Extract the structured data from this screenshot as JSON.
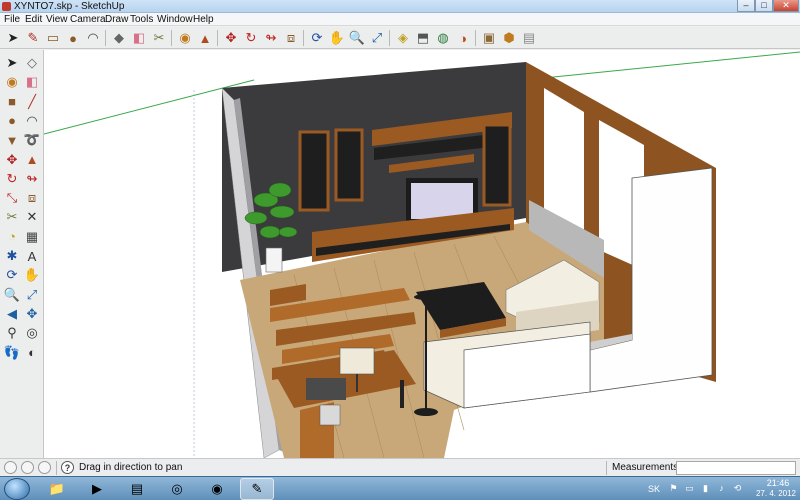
{
  "window": {
    "title": "XYNTO7.skp - SketchUp",
    "minimize": "–",
    "maximize": "□",
    "close": "✕"
  },
  "menu": [
    "File",
    "Edit",
    "View",
    "Camera",
    "Draw",
    "Tools",
    "Window",
    "Help"
  ],
  "toolbar": {
    "tools": [
      {
        "name": "select-tool",
        "glyph": "➤",
        "color": "#222222"
      },
      {
        "name": "pencil-line-tool",
        "glyph": "✎",
        "color": "#b03020"
      },
      {
        "name": "rectangle-tool",
        "glyph": "▭",
        "color": "#8a5a2b"
      },
      {
        "name": "circle-tool",
        "glyph": "●",
        "color": "#8a5a2b"
      },
      {
        "name": "arc-tool",
        "glyph": "◠",
        "color": "#444444"
      },
      {
        "name": "make-component-tool",
        "glyph": "◆",
        "color": "#666666"
      },
      {
        "name": "eraser-tool",
        "glyph": "◧",
        "color": "#d8708a"
      },
      {
        "name": "tape-measure-tool",
        "glyph": "✂",
        "color": "#6a7a3a"
      },
      {
        "name": "paint-bucket-tool",
        "glyph": "◉",
        "color": "#c07a20"
      },
      {
        "name": "push-pull-tool",
        "glyph": "▲",
        "color": "#b04a20"
      },
      {
        "name": "move-tool",
        "glyph": "✥",
        "color": "#b02020"
      },
      {
        "name": "rotate-tool",
        "glyph": "↻",
        "color": "#c02020"
      },
      {
        "name": "follow-me-tool",
        "glyph": "↬",
        "color": "#c02020"
      },
      {
        "name": "offset-tool",
        "glyph": "⧈",
        "color": "#8a5a2b"
      },
      {
        "name": "orbit-tool",
        "glyph": "⟳",
        "color": "#2050a0"
      },
      {
        "name": "pan-tool",
        "glyph": "✋",
        "color": "#444444"
      },
      {
        "name": "zoom-tool",
        "glyph": "🔍",
        "color": "#333333"
      },
      {
        "name": "zoom-extents-tool",
        "glyph": "⤢",
        "color": "#2060a0"
      },
      {
        "name": "section-plane-tool",
        "glyph": "◈",
        "color": "#c0a020"
      },
      {
        "name": "walk-tool",
        "glyph": "⬒",
        "color": "#555555"
      },
      {
        "name": "look-around-tool",
        "glyph": "◍",
        "color": "#2a7a3a"
      },
      {
        "name": "position-camera-tool",
        "glyph": "◑",
        "color": "#c04a20"
      },
      {
        "name": "components-tool",
        "glyph": "▣",
        "color": "#8a6a3a"
      },
      {
        "name": "materials-tool",
        "glyph": "⬢",
        "color": "#c07a20"
      },
      {
        "name": "styles-tool",
        "glyph": "▤",
        "color": "#888888"
      }
    ]
  },
  "left_toolbar": {
    "tools": [
      {
        "name": "select-tool",
        "glyph": "➤",
        "color": "#222222"
      },
      {
        "name": "make-component-tool",
        "glyph": "◇",
        "color": "#666666"
      },
      {
        "name": "paint-bucket-tool",
        "glyph": "◉",
        "color": "#c07a20"
      },
      {
        "name": "eraser-tool",
        "glyph": "◧",
        "color": "#d8708a"
      },
      {
        "name": "rectangle-tool",
        "glyph": "■",
        "color": "#8a5a2b"
      },
      {
        "name": "line-tool",
        "glyph": "╱",
        "color": "#b03020"
      },
      {
        "name": "circle-tool",
        "glyph": "●",
        "color": "#8a5a2b"
      },
      {
        "name": "arc-tool",
        "glyph": "◠",
        "color": "#444444"
      },
      {
        "name": "polygon-tool",
        "glyph": "▼",
        "color": "#8a5a2b"
      },
      {
        "name": "freehand-tool",
        "glyph": "➰",
        "color": "#333333"
      },
      {
        "name": "move-tool",
        "glyph": "✥",
        "color": "#b02020"
      },
      {
        "name": "push-pull-tool",
        "glyph": "▲",
        "color": "#b04a20"
      },
      {
        "name": "rotate-tool",
        "glyph": "↻",
        "color": "#c02020"
      },
      {
        "name": "follow-me-tool",
        "glyph": "↬",
        "color": "#c02020"
      },
      {
        "name": "scale-tool",
        "glyph": "⤡",
        "color": "#c02020"
      },
      {
        "name": "offset-tool",
        "glyph": "⧈",
        "color": "#8a5a2b"
      },
      {
        "name": "tape-measure-tool",
        "glyph": "✂",
        "color": "#6a7a3a"
      },
      {
        "name": "dimension-tool",
        "glyph": "✕",
        "color": "#333333"
      },
      {
        "name": "protractor-tool",
        "glyph": "◔",
        "color": "#c0a020"
      },
      {
        "name": "text-tool",
        "glyph": "▦",
        "color": "#444444"
      },
      {
        "name": "axes-tool",
        "glyph": "✱",
        "color": "#2050a0"
      },
      {
        "name": "3d-text-tool",
        "glyph": "A",
        "color": "#333333"
      },
      {
        "name": "orbit-tool",
        "glyph": "⟳",
        "color": "#2050a0"
      },
      {
        "name": "pan-tool",
        "glyph": "✋",
        "color": "#444444"
      },
      {
        "name": "zoom-tool",
        "glyph": "🔍",
        "color": "#333333"
      },
      {
        "name": "zoom-window-tool",
        "glyph": "⤢",
        "color": "#2060a0"
      },
      {
        "name": "zoom-previous-tool",
        "glyph": "◀",
        "color": "#2060a0"
      },
      {
        "name": "zoom-extents-tool",
        "glyph": "✥",
        "color": "#2060a0"
      },
      {
        "name": "position-camera-tool",
        "glyph": "⚲",
        "color": "#333333"
      },
      {
        "name": "look-around-tool",
        "glyph": "◎",
        "color": "#333333"
      },
      {
        "name": "walk-tool",
        "glyph": "👣",
        "color": "#333333"
      },
      {
        "name": "section-plane-tool",
        "glyph": "◐",
        "color": "#333333"
      }
    ]
  },
  "status": {
    "hint": "Drag in direction to pan",
    "help_glyph": "?",
    "measurements_label": "Measurements",
    "measurements_value": ""
  },
  "taskbar": {
    "apps": [
      {
        "name": "explorer-app",
        "glyph": "📁",
        "active": false
      },
      {
        "name": "media-player-app",
        "glyph": "▶",
        "active": false
      },
      {
        "name": "documents-app",
        "glyph": "▤",
        "active": false
      },
      {
        "name": "network-app",
        "glyph": "◎",
        "active": false
      },
      {
        "name": "firefox-app",
        "glyph": "◉",
        "active": false
      },
      {
        "name": "sketchup-app",
        "glyph": "✎",
        "active": true
      }
    ],
    "language": "SK",
    "time": "21:46",
    "date": "27. 4. 2012"
  },
  "colors": {
    "wall_dark": "#3b3b3e",
    "wood": "#9a5a22",
    "floor": "#c8a878",
    "axis_green": "#3aa84a",
    "sofa": "#f3eee2"
  }
}
